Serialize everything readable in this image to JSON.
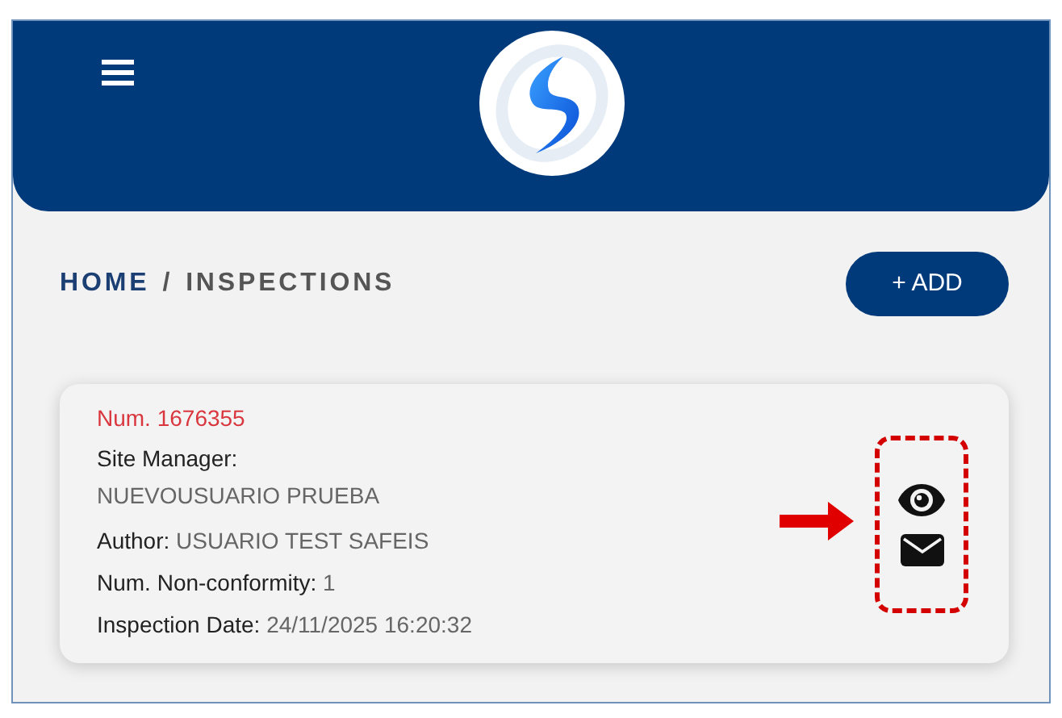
{
  "breadcrumb": [
    {
      "label": "HOME",
      "selected": false
    },
    {
      "label": "INSPECTIONS",
      "selected": true
    }
  ],
  "breadcrumb_separator": "/",
  "add_button": "+ ADD",
  "inspections": [
    {
      "number": "Num. 1676355",
      "fields": [
        {
          "kind": "stacked",
          "label": "Site Manager:",
          "value": "NUEVOUSUARIO PRUEBA"
        },
        {
          "kind": "inline",
          "label": "Author:",
          "value": "USUARIO TEST SAFEIS"
        },
        {
          "kind": "inline",
          "label": "Num. Non-conformity:",
          "value": "1"
        },
        {
          "kind": "inline",
          "label": "Inspection Date:",
          "value": "24/11/2025 16:20:32"
        }
      ]
    }
  ]
}
